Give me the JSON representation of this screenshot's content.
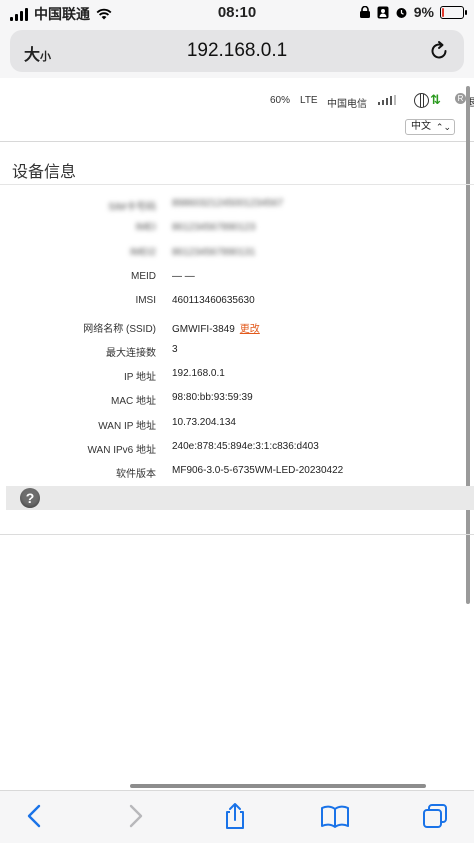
{
  "status_bar": {
    "carrier": "中国联通",
    "time": "08:10",
    "battery_percent": "9%",
    "battery_level": 0.09
  },
  "browser": {
    "text_size_label_big": "大",
    "text_size_label_small": "小",
    "url": "192.168.0.1"
  },
  "router_header": {
    "battery": "60%",
    "network_type": "LTE",
    "operator": "中国电信",
    "roaming_badge": "R",
    "edge_text": "退",
    "language": "中文"
  },
  "section": {
    "title": "设备信息"
  },
  "device_info": [
    {
      "label": "SIM卡号码",
      "value": "89860321245001234567",
      "blurred": true
    },
    {
      "label": "IMEI",
      "value": "861234567890123",
      "blurred": true
    },
    {
      "label": "IMEI2",
      "value": "861234567890131",
      "blurred": true
    },
    {
      "label": "MEID",
      "value": "— —"
    },
    {
      "label": "IMSI",
      "value": "460113460635630"
    },
    {
      "label": "网络名称 (SSID)",
      "value": "GMWIFI-3849",
      "link": "更改"
    },
    {
      "label": "最大连接数",
      "value": "3"
    },
    {
      "label": "IP 地址",
      "value": "192.168.0.1"
    },
    {
      "label": "MAC 地址",
      "value": "98:80:bb:93:59:39"
    },
    {
      "label": "WAN IP 地址",
      "value": "10.73.204.134"
    },
    {
      "label": "WAN IPv6 地址",
      "value": "240e:878:45:894e:3:1:c836:d403"
    },
    {
      "label": "软件版本",
      "value": "MF906-3.0-5-6735WM-LED-20230422"
    }
  ],
  "help": {
    "icon_label": "?"
  },
  "icons": {
    "wifi": "wifi-icon",
    "reload": "reload-icon",
    "back": "back-icon",
    "forward": "forward-icon",
    "share": "share-icon",
    "bookmarks": "bookmarks-icon",
    "tabs": "tabs-icon"
  },
  "colors": {
    "link": "#e2591b",
    "battery_low": "#e23b2e",
    "safari_blue": "#1a73e8",
    "signal_green": "#2a9a1e"
  }
}
